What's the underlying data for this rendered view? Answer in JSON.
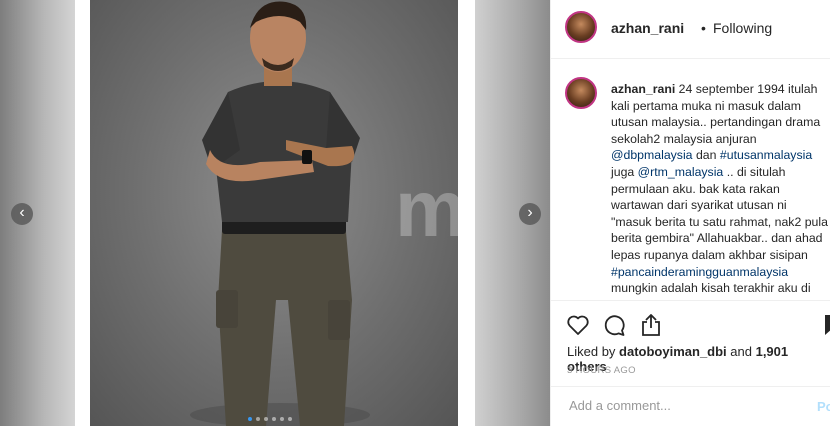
{
  "post": {
    "username": "azhan_rani",
    "separator": "•",
    "follow_status": "Following",
    "more_label": "...",
    "caption_user": "azhan_rani",
    "caption_segments": [
      {
        "text": " 24 september 1994 itulah kali pertama muka ni masuk dalam utusan malaysia.. pertandingan drama sekolah2 malaysia anjuran ",
        "type": "text"
      },
      {
        "text": "@dbpmalaysia",
        "type": "tag"
      },
      {
        "text": " dan ",
        "type": "text"
      },
      {
        "text": "#utusanmalaysia",
        "type": "tag"
      },
      {
        "text": " juga ",
        "type": "text"
      },
      {
        "text": "@rtm_malaysia",
        "type": "tag"
      },
      {
        "text": " .. di situlah permulaan aku. bak kata rakan wartawan dari syarikat utusan ni \"masuk berita tu satu rahmat, nak2 pula berita gembira\" Allahuakbar.. dan ahad lepas rupanya dalam akhbar sisipan ",
        "type": "text"
      },
      {
        "text": "#pancainderamingguanmalaysia",
        "type": "tag"
      },
      {
        "text": " mungkin adalah kisah terakhir aku di",
        "type": "text"
      }
    ],
    "likes_prefix": "Liked by ",
    "liked_by": "datoboyiman_dbi",
    "likes_and": " and ",
    "likes_count": "1,901 others",
    "time_ago": "3 HOURS AGO",
    "comment_placeholder": "Add a comment...",
    "post_button": "Po"
  },
  "media": {
    "watermark": "mStar",
    "prev_glyph": "‹",
    "next_glyph": "›",
    "dot_count": 6,
    "active_dot": 0
  },
  "icons": {
    "like": "heart-outline-icon",
    "comment": "speech-bubble-icon",
    "share": "share-upload-icon",
    "save": "bookmark-icon"
  },
  "colors": {
    "link": "#003569",
    "story_ring": "#c13584",
    "muted": "#999999"
  }
}
